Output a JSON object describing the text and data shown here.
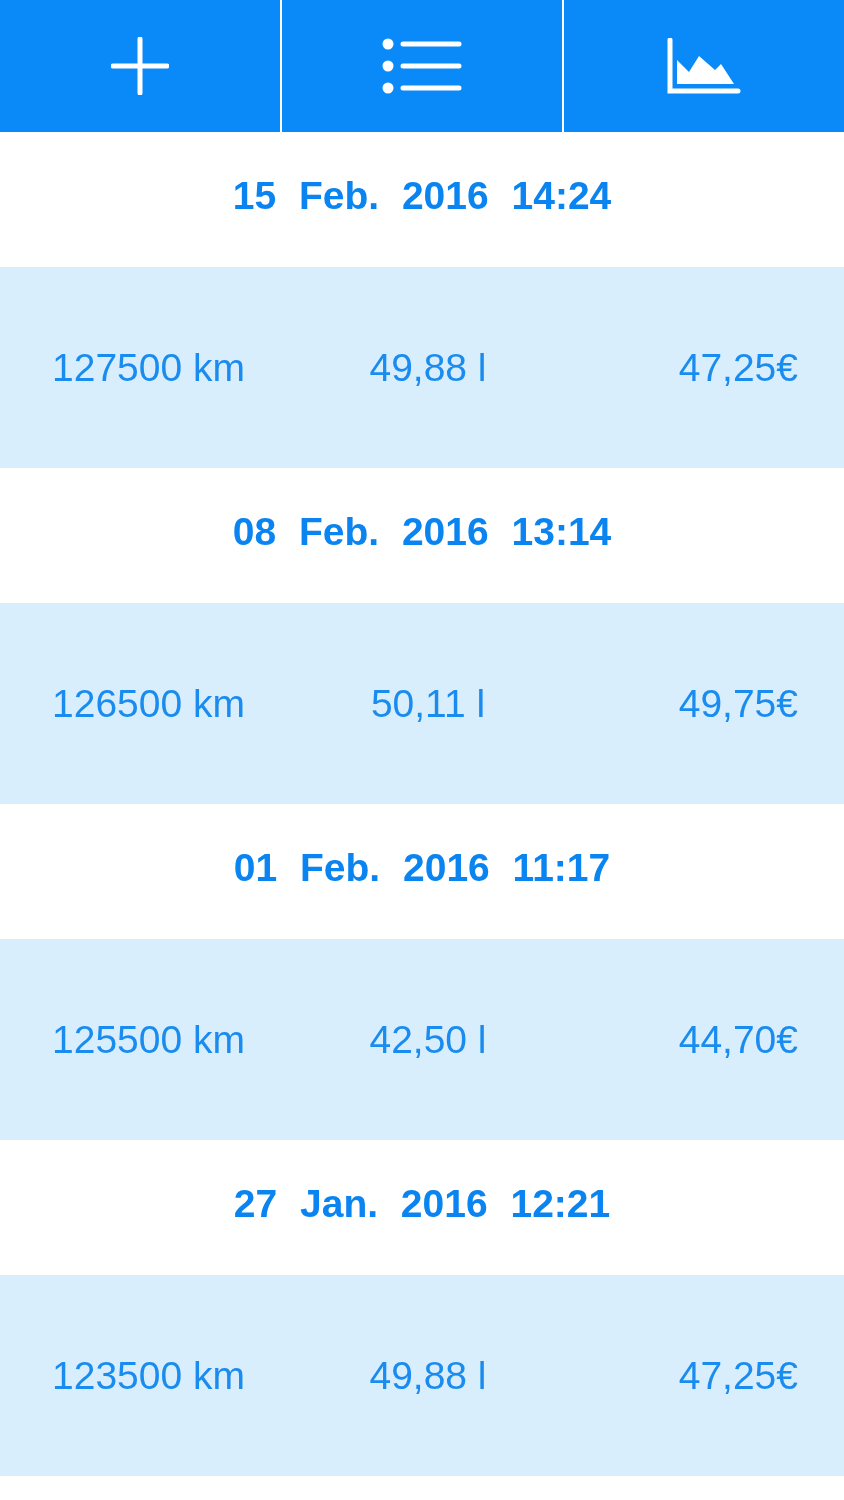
{
  "toolbar": {
    "buttons": [
      {
        "kind": "add"
      },
      {
        "kind": "list"
      },
      {
        "kind": "chart"
      }
    ]
  },
  "entries": [
    {
      "date": "15 Feb. 2016 14:24",
      "distance": "127500 km",
      "volume": "49,88 l",
      "cost": "47,25€"
    },
    {
      "date": "08 Feb. 2016 13:14",
      "distance": "126500 km",
      "volume": "50,11 l",
      "cost": "49,75€"
    },
    {
      "date": "01 Feb. 2016 11:17",
      "distance": "125500 km",
      "volume": "42,50 l",
      "cost": "44,70€"
    },
    {
      "date": "27 Jan. 2016 12:21",
      "distance": "123500 km",
      "volume": "49,88 l",
      "cost": "47,25€"
    }
  ]
}
